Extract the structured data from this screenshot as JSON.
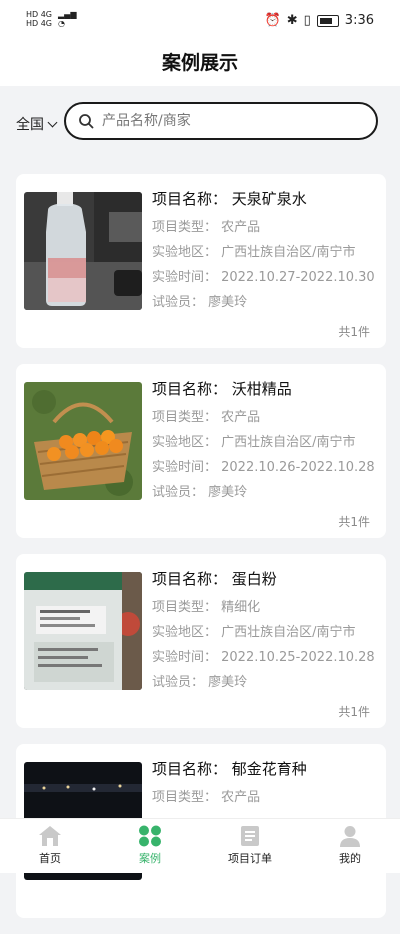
{
  "status": {
    "time": "3:36",
    "net1": "HD 4G",
    "net2": "HD 4G"
  },
  "header": {
    "title": "案例展示"
  },
  "search": {
    "region": "全国",
    "placeholder": "产品名称/商家"
  },
  "cards": [
    {
      "name": "项目名称：  天泉矿泉水",
      "type": "项目类型：  农产品",
      "region": "实验地区：  广西壮族自治区/南宁市",
      "time": "实验时间：  2022.10.27-2022.10.30",
      "tester": "试验员：  廖美玲",
      "count": "共1件"
    },
    {
      "name": "项目名称：  沃柑精品",
      "type": "项目类型：  农产品",
      "region": "实验地区：  广西壮族自治区/南宁市",
      "time": "实验时间：  2022.10.26-2022.10.28",
      "tester": "试验员：  廖美玲",
      "count": "共1件"
    },
    {
      "name": "项目名称：  蛋白粉",
      "type": "项目类型：  精细化",
      "region": "实验地区：  广西壮族自治区/南宁市",
      "time": "实验时间：  2022.10.25-2022.10.28",
      "tester": "试验员：  廖美玲",
      "count": "共1件"
    },
    {
      "name": "项目名称：  郁金花育种",
      "type": "项目类型：  农产品",
      "region": "",
      "time": "",
      "tester": "",
      "count": ""
    }
  ],
  "tabs": [
    {
      "label": "首页",
      "icon": "home-icon"
    },
    {
      "label": "案例",
      "icon": "grid-icon"
    },
    {
      "label": "项目订单",
      "icon": "document-icon"
    },
    {
      "label": "我的",
      "icon": "user-icon"
    }
  ],
  "colors": {
    "accent": "#37b36b",
    "inactive": "#c9c9c9"
  }
}
